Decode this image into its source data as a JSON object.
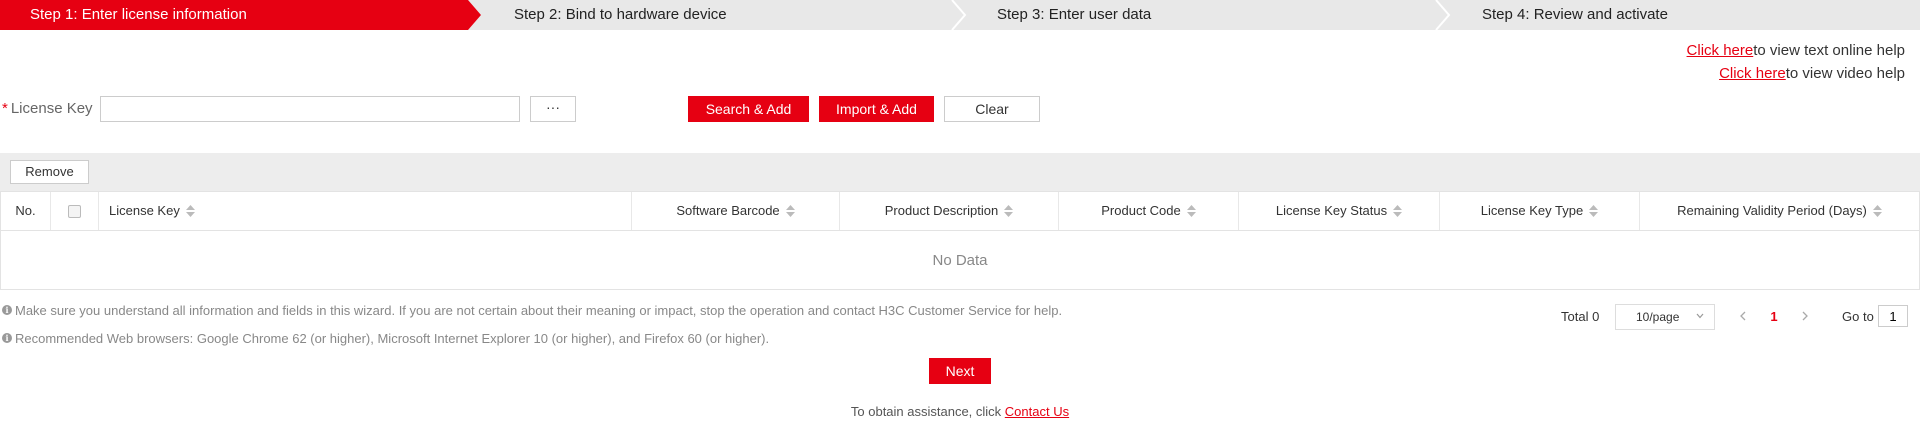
{
  "steps": [
    {
      "label": "Step 1: Enter license information",
      "active": true
    },
    {
      "label": "Step 2: Bind to hardware device",
      "active": false
    },
    {
      "label": "Step 3: Enter user data",
      "active": false
    },
    {
      "label": "Step 4: Review and activate",
      "active": false
    }
  ],
  "help": {
    "link_text": "Click here",
    "text_online": "to view text online help",
    "video_link_text": "Click here",
    "text_video": "to view video help"
  },
  "form": {
    "required_mark": "*",
    "license_key_label": "License Key",
    "license_key_value": "",
    "browse_label": "···",
    "search_add_label": "Search & Add",
    "import_add_label": "Import & Add",
    "clear_label": "Clear"
  },
  "toolbar": {
    "remove_label": "Remove"
  },
  "table": {
    "columns": {
      "no": "No.",
      "license_key": "License Key",
      "software_barcode": "Software Barcode",
      "product_description": "Product Description",
      "product_code": "Product Code",
      "license_key_status": "License Key Status",
      "license_key_type": "License Key Type",
      "remaining_validity": "Remaining Validity Period (Days)"
    },
    "empty_text": "No Data"
  },
  "notes": [
    "Make sure you understand all information and fields in this wizard. If you are not certain about their meaning or impact, stop the operation and contact H3C Customer Service for help.",
    "Recommended Web browsers: Google Chrome 62 (or higher), Microsoft Internet Explorer 10 (or higher), and Firefox 60 (or higher)."
  ],
  "pagination": {
    "total_label": "Total 0",
    "page_size": "10/page",
    "current_page": "1",
    "goto_label": "Go to",
    "goto_value": "1"
  },
  "actions": {
    "next_label": "Next"
  },
  "footer": {
    "prefix": "To obtain assistance, click ",
    "link_text": "Contact Us"
  },
  "colors": {
    "accent": "#e60012",
    "step_bar_bg": "#e8e8e8"
  }
}
